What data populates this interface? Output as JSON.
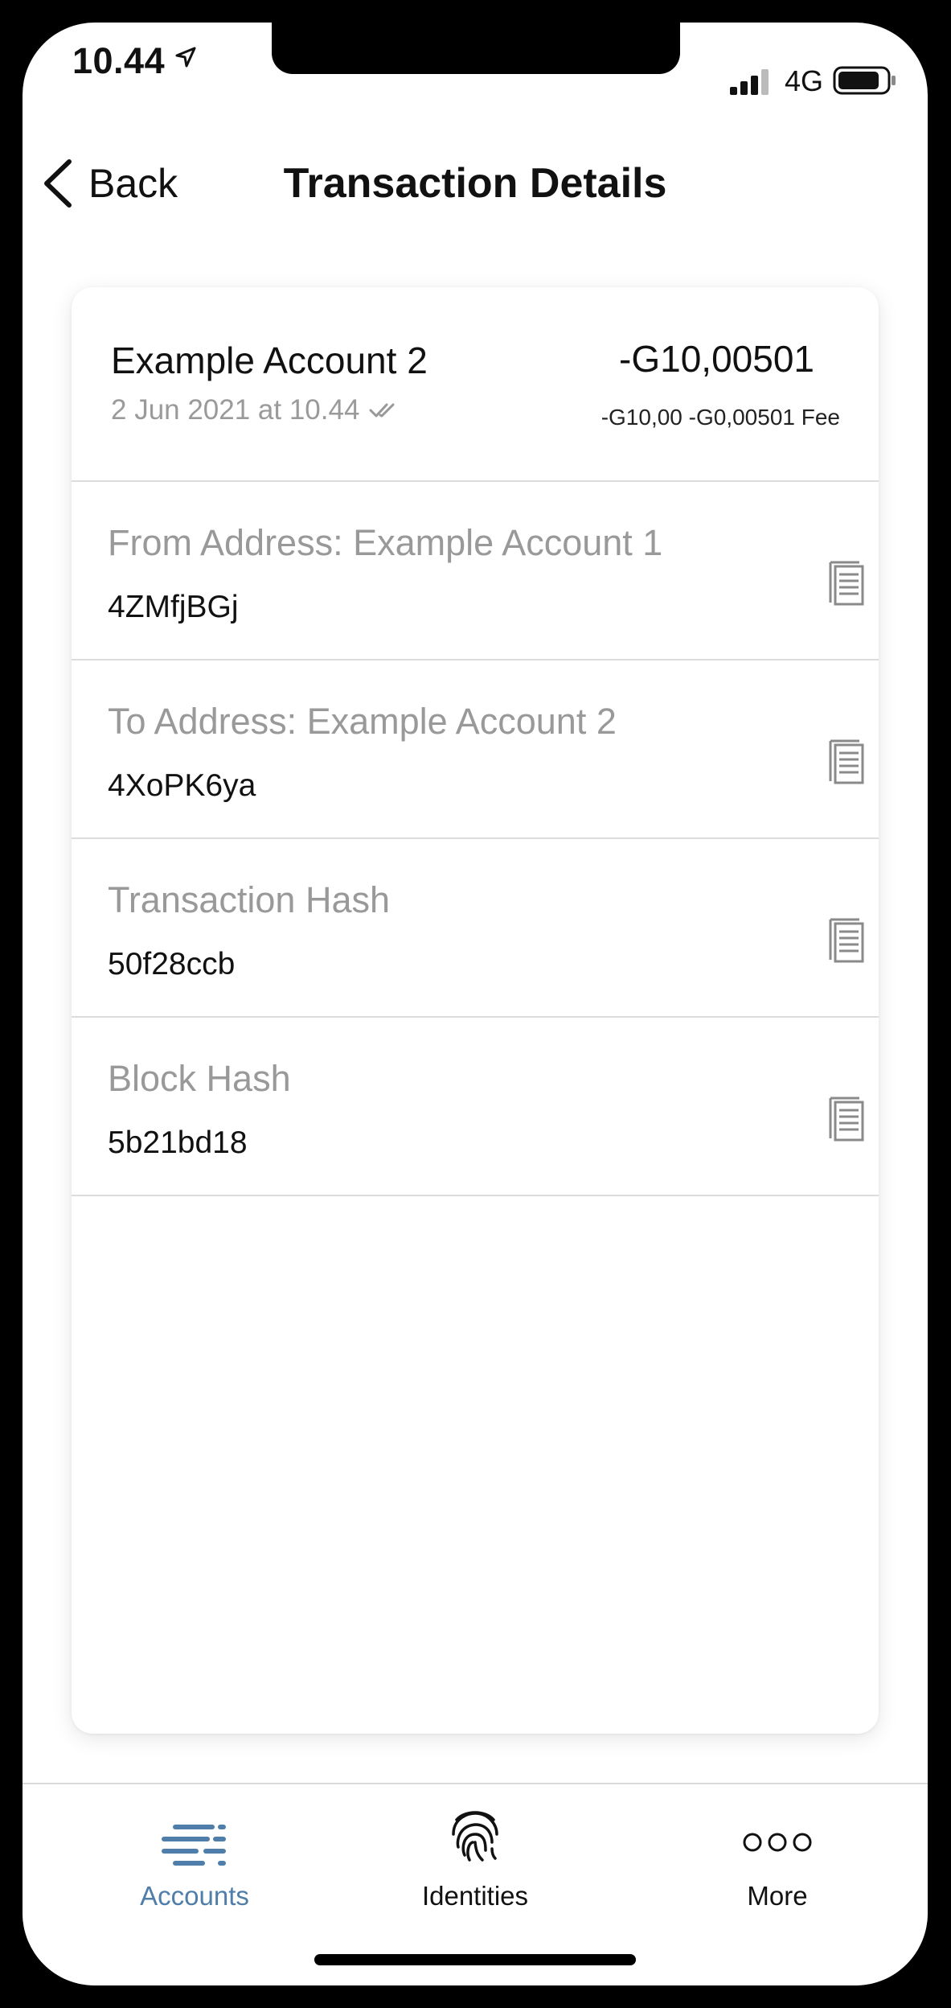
{
  "status_bar": {
    "time": "10.44",
    "network": "4G"
  },
  "nav": {
    "back_label": "Back",
    "title": "Transaction Details"
  },
  "transaction": {
    "account": "Example Account 2",
    "date": "2 Jun 2021 at 10.44",
    "amount": "-G10,00501",
    "breakdown": "-G10,00 -G0,00501 Fee"
  },
  "fields": [
    {
      "label": "From Address: Example Account 1",
      "value": "4ZMfjBGj"
    },
    {
      "label": "To Address: Example Account 2",
      "value": "4XoPK6ya"
    },
    {
      "label": "Transaction Hash",
      "value": "50f28ccb"
    },
    {
      "label": "Block Hash",
      "value": "5b21bd18"
    }
  ],
  "tabs": [
    {
      "label": "Accounts",
      "icon": "accounts-list-icon",
      "active": true
    },
    {
      "label": "Identities",
      "icon": "fingerprint-icon",
      "active": false
    },
    {
      "label": "More",
      "icon": "more-dots-icon",
      "active": false
    }
  ],
  "colors": {
    "accent": "#4e7ea9",
    "label_gray": "#999999",
    "divider": "#dcdcdc"
  }
}
